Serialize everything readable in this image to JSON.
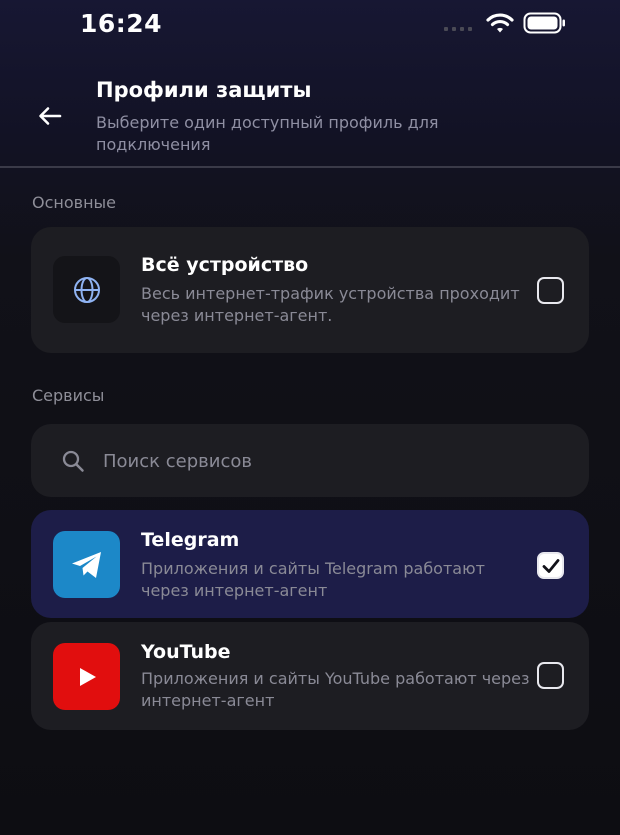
{
  "status_bar": {
    "time": "16:24"
  },
  "header": {
    "title": "Профили защиты",
    "subtitle": "Выберите один доступный профиль для подключения"
  },
  "sections": {
    "main_label": "Основные",
    "services_label": "Сервисы"
  },
  "whole_device": {
    "icon": "globe-icon",
    "title": "Всё устройство",
    "description": "Весь интернет-трафик устройства проходит через интернет-агент.",
    "checked": false
  },
  "search": {
    "placeholder": "Поиск сервисов",
    "value": ""
  },
  "services": [
    {
      "icon": "telegram-icon",
      "icon_color": "#1c88c8",
      "title": "Telegram",
      "description": "Приложения и сайты Telegram работают через интернет-агент",
      "checked": true
    },
    {
      "icon": "youtube-icon",
      "icon_color": "#e10e0e",
      "title": "YouTube",
      "description": "Приложения и сайты YouTube работают через интернет-агент",
      "checked": false
    }
  ],
  "colors": {
    "accent_selected": "#1d1d48",
    "card": "#1d1d22",
    "background": "#111118"
  }
}
